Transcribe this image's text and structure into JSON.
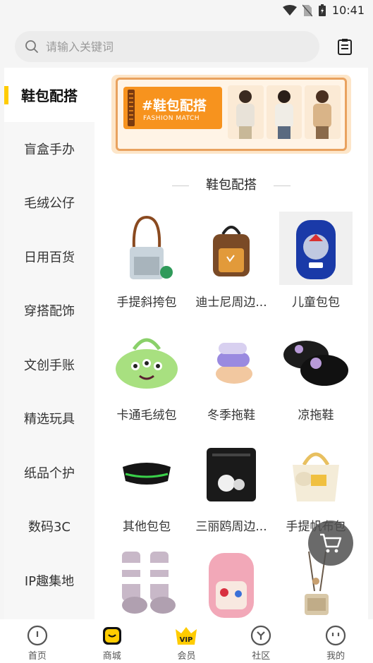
{
  "status_bar": {
    "time": "10:41"
  },
  "search": {
    "placeholder": "请输入关键词"
  },
  "sidebar": {
    "items": [
      {
        "label": "鞋包配搭",
        "active": true
      },
      {
        "label": "盲盒手办"
      },
      {
        "label": "毛绒公仔"
      },
      {
        "label": "日用百货"
      },
      {
        "label": "穿搭配饰"
      },
      {
        "label": "文创手账"
      },
      {
        "label": "精选玩具"
      },
      {
        "label": "纸品个护"
      },
      {
        "label": "数码3C"
      },
      {
        "label": "IP趣集地"
      }
    ]
  },
  "banner": {
    "title": "#鞋包配搭",
    "subtitle": "FASHION MATCH"
  },
  "section": {
    "title": "鞋包配搭"
  },
  "products": [
    {
      "label": "手提斜挎包",
      "icon": "crossbody-bag"
    },
    {
      "label": "迪士尼周边...",
      "icon": "backpack-brown"
    },
    {
      "label": "儿童包包",
      "icon": "kids-backpack"
    },
    {
      "label": "卡通毛绒包",
      "icon": "alien-plush-bag"
    },
    {
      "label": "冬季拖鞋",
      "icon": "winter-slippers"
    },
    {
      "label": "凉拖鞋",
      "icon": "sandals"
    },
    {
      "label": "其他包包",
      "icon": "waist-bag"
    },
    {
      "label": "三丽鸥周边...",
      "icon": "black-bag"
    },
    {
      "label": "手提帆布包",
      "icon": "canvas-tote"
    },
    {
      "label": "",
      "icon": "socks"
    },
    {
      "label": "",
      "icon": "pink-backpack"
    },
    {
      "label": "",
      "icon": "small-shoulder-bag"
    }
  ],
  "tabbar": {
    "items": [
      {
        "label": "首页",
        "icon": "home-icon"
      },
      {
        "label": "商城",
        "icon": "mall-icon"
      },
      {
        "label": "会员",
        "icon": "vip-icon"
      },
      {
        "label": "社区",
        "icon": "community-icon"
      },
      {
        "label": "我的",
        "icon": "profile-icon"
      }
    ]
  },
  "colors": {
    "accent": "#ffcc00",
    "banner_orange": "#f7931e"
  }
}
